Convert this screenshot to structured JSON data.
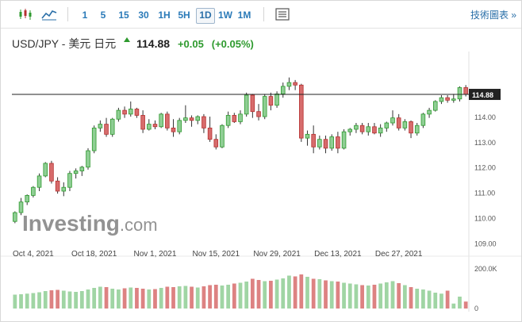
{
  "toolbar": {
    "intervals": [
      "1",
      "5",
      "15",
      "30",
      "1H",
      "5H",
      "1D",
      "1W",
      "1M"
    ],
    "active_interval": "1D",
    "tech_chart_label": "技術圖表 »",
    "icons": [
      "candlestick-chart-icon",
      "line-chart-icon",
      "chart-settings-icon"
    ]
  },
  "header": {
    "symbol": "USD/JPY - 美元 日元",
    "price": "114.88",
    "change": "+0.05",
    "change_pct": "(+0.05%)"
  },
  "watermark": {
    "brand": "Investing",
    "suffix": ".com"
  },
  "colors": {
    "up": "#8fce94",
    "down": "#d76c6c",
    "up_border": "#2e9a2e",
    "down_border": "#b53030"
  },
  "chart_data": {
    "type": "candlestick",
    "y_ticks": [
      "109.00",
      "110.00",
      "111.00",
      "112.00",
      "113.00",
      "114.00"
    ],
    "y_tick_values": [
      109,
      110,
      111,
      112,
      113,
      114
    ],
    "ylim": [
      108.6,
      116.2
    ],
    "current_price_label": "114.88",
    "current_price": 114.88,
    "x_labels": [
      "Oct 4, 2021",
      "Oct 18, 2021",
      "Nov 1, 2021",
      "Nov 15, 2021",
      "Nov 29, 2021",
      "Dec 13, 2021",
      "Dec 27, 2021"
    ],
    "x_label_indices": [
      3,
      13,
      23,
      33,
      43,
      53,
      63
    ],
    "volume_ticks": [
      "200.0K",
      "0"
    ],
    "volume_tick_values": [
      200000,
      0
    ],
    "volume_max": 200000,
    "ohlc": [
      [
        109.85,
        110.25,
        109.78,
        110.2
      ],
      [
        110.2,
        110.78,
        110.1,
        110.62
      ],
      [
        110.62,
        110.92,
        110.5,
        110.88
      ],
      [
        110.88,
        111.25,
        110.8,
        111.2
      ],
      [
        111.2,
        111.75,
        111.05,
        111.65
      ],
      [
        111.65,
        112.2,
        111.6,
        112.15
      ],
      [
        112.15,
        112.25,
        111.35,
        111.45
      ],
      [
        111.45,
        111.6,
        110.95,
        111.05
      ],
      [
        111.05,
        111.4,
        110.85,
        111.2
      ],
      [
        111.2,
        111.85,
        111.05,
        111.75
      ],
      [
        111.75,
        111.95,
        111.55,
        111.85
      ],
      [
        111.85,
        112.05,
        111.65,
        112.0
      ],
      [
        112.0,
        112.75,
        111.9,
        112.65
      ],
      [
        112.65,
        113.65,
        112.55,
        113.55
      ],
      [
        113.55,
        113.85,
        113.4,
        113.7
      ],
      [
        113.7,
        113.95,
        113.2,
        113.3
      ],
      [
        113.3,
        113.95,
        113.2,
        113.9
      ],
      [
        113.9,
        114.35,
        113.8,
        114.25
      ],
      [
        114.25,
        114.4,
        113.95,
        114.1
      ],
      [
        114.1,
        114.6,
        114.0,
        114.3
      ],
      [
        114.3,
        114.35,
        113.95,
        114.05
      ],
      [
        114.05,
        114.25,
        113.35,
        113.5
      ],
      [
        113.5,
        113.9,
        113.45,
        113.7
      ],
      [
        113.7,
        113.85,
        113.5,
        113.6
      ],
      [
        113.6,
        114.15,
        113.55,
        114.1
      ],
      [
        114.1,
        114.2,
        113.45,
        113.55
      ],
      [
        113.55,
        113.9,
        113.2,
        113.4
      ],
      [
        113.4,
        113.95,
        113.3,
        113.85
      ],
      [
        113.85,
        114.45,
        113.75,
        113.95
      ],
      [
        113.95,
        114.05,
        113.6,
        113.85
      ],
      [
        113.85,
        114.05,
        113.7,
        114.0
      ],
      [
        114.0,
        114.1,
        113.35,
        113.55
      ],
      [
        113.55,
        114.0,
        113.0,
        113.1
      ],
      [
        113.1,
        113.3,
        112.7,
        112.8
      ],
      [
        112.8,
        113.7,
        112.75,
        113.65
      ],
      [
        113.65,
        114.2,
        113.55,
        114.05
      ],
      [
        114.05,
        114.15,
        113.75,
        113.8
      ],
      [
        113.8,
        114.25,
        113.7,
        114.1
      ],
      [
        114.1,
        114.95,
        114.0,
        114.85
      ],
      [
        114.85,
        114.9,
        113.95,
        114.2
      ],
      [
        114.2,
        114.5,
        113.85,
        114.0
      ],
      [
        114.0,
        114.9,
        113.9,
        114.8
      ],
      [
        114.8,
        114.95,
        114.25,
        114.45
      ],
      [
        114.45,
        115.0,
        114.35,
        114.9
      ],
      [
        114.9,
        115.35,
        114.75,
        115.2
      ],
      [
        115.2,
        115.55,
        115.05,
        115.35
      ],
      [
        115.35,
        115.45,
        115.05,
        115.25
      ],
      [
        115.25,
        115.3,
        113.0,
        113.15
      ],
      [
        113.15,
        113.45,
        112.85,
        113.3
      ],
      [
        113.3,
        113.65,
        112.55,
        112.8
      ],
      [
        112.8,
        113.25,
        112.7,
        113.1
      ],
      [
        113.1,
        113.25,
        112.55,
        112.75
      ],
      [
        112.75,
        113.3,
        112.65,
        113.2
      ],
      [
        113.2,
        113.4,
        112.55,
        112.75
      ],
      [
        112.75,
        113.5,
        112.7,
        113.4
      ],
      [
        113.4,
        113.55,
        113.25,
        113.5
      ],
      [
        113.5,
        113.75,
        113.35,
        113.65
      ],
      [
        113.65,
        113.75,
        113.3,
        113.4
      ],
      [
        113.4,
        113.75,
        113.25,
        113.6
      ],
      [
        113.6,
        113.75,
        113.3,
        113.35
      ],
      [
        113.35,
        113.7,
        113.2,
        113.55
      ],
      [
        113.55,
        113.8,
        113.4,
        113.75
      ],
      [
        113.75,
        114.25,
        113.65,
        113.95
      ],
      [
        113.95,
        114.1,
        113.45,
        113.55
      ],
      [
        113.55,
        113.9,
        113.45,
        113.8
      ],
      [
        113.8,
        113.85,
        113.15,
        113.35
      ],
      [
        113.35,
        113.75,
        113.25,
        113.65
      ],
      [
        113.65,
        114.15,
        113.55,
        114.1
      ],
      [
        114.1,
        114.35,
        113.95,
        114.25
      ],
      [
        114.25,
        114.65,
        114.2,
        114.6
      ],
      [
        114.6,
        114.85,
        114.5,
        114.75
      ],
      [
        114.75,
        114.85,
        114.55,
        114.65
      ],
      [
        114.65,
        114.9,
        114.55,
        114.7
      ],
      [
        114.7,
        115.2,
        114.6,
        115.15
      ],
      [
        115.15,
        115.25,
        114.8,
        114.88
      ]
    ],
    "volume": [
      70000,
      72000,
      75000,
      78000,
      82000,
      88000,
      92000,
      94000,
      90000,
      86000,
      84000,
      88000,
      96000,
      104000,
      110000,
      108000,
      100000,
      96000,
      102000,
      106000,
      104000,
      100000,
      96000,
      98000,
      104000,
      110000,
      108000,
      112000,
      114000,
      110000,
      106000,
      112000,
      118000,
      120000,
      116000,
      120000,
      126000,
      130000,
      136000,
      150000,
      144000,
      138000,
      140000,
      146000,
      152000,
      166000,
      162000,
      172000,
      160000,
      150000,
      148000,
      142000,
      138000,
      136000,
      130000,
      126000,
      122000,
      118000,
      116000,
      120000,
      126000,
      132000,
      138000,
      128000,
      118000,
      108000,
      100000,
      96000,
      90000,
      80000,
      75000,
      90000,
      25000,
      60000,
      35000
    ]
  }
}
